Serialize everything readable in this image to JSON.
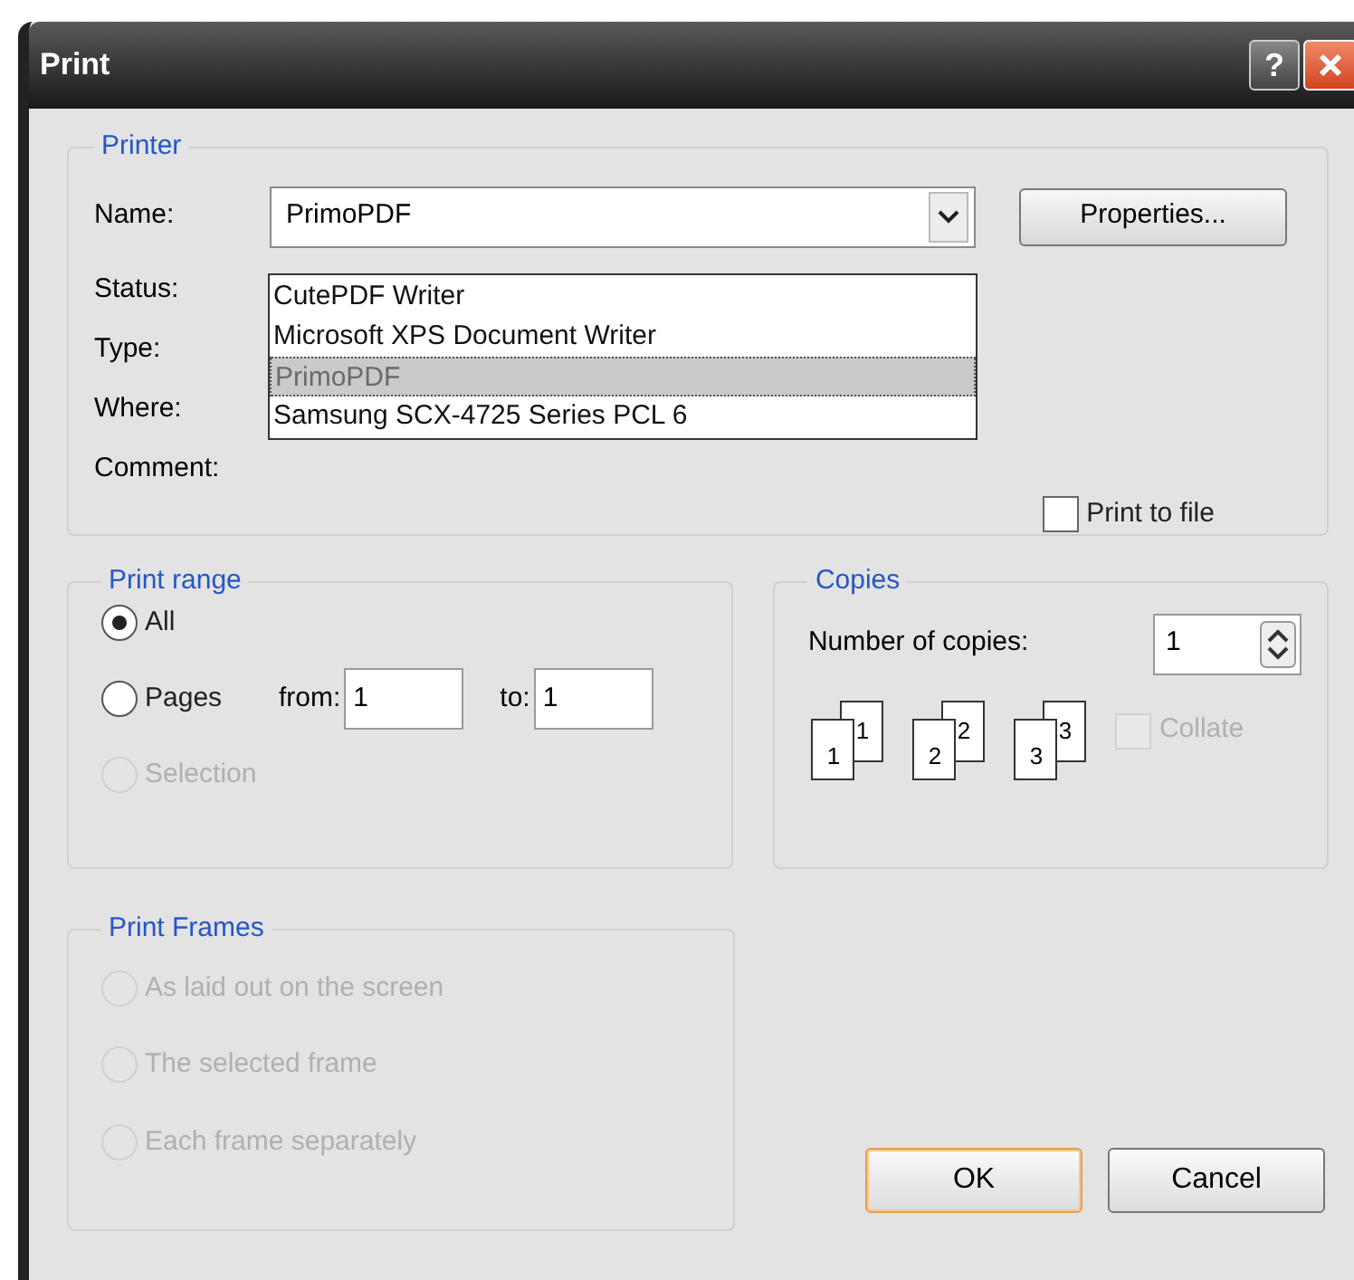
{
  "window": {
    "title": "Print",
    "help_button": "?"
  },
  "printer": {
    "title": "Printer",
    "name_label": "Name:",
    "name_value": "PrimoPDF",
    "dropdown_options": [
      {
        "label": "CutePDF Writer",
        "selected": false
      },
      {
        "label": "Microsoft XPS Document Writer",
        "selected": false
      },
      {
        "label": "PrimoPDF",
        "selected": true
      },
      {
        "label": "Samsung SCX-4725 Series PCL 6",
        "selected": false
      }
    ],
    "properties_button": "Properties...",
    "fields": [
      {
        "label": "Status:"
      },
      {
        "label": "Type:"
      },
      {
        "label": "Where:"
      },
      {
        "label": "Comment:"
      }
    ],
    "print_to_file": {
      "label": "Print to file",
      "checked": false
    }
  },
  "print_range": {
    "title": "Print range",
    "options": [
      {
        "kind": "plain",
        "label": "All",
        "selected": true,
        "disabled": false
      },
      {
        "kind": "pages",
        "label": "Pages",
        "selected": false,
        "disabled": false
      },
      {
        "kind": "plain",
        "label": "Selection",
        "selected": false,
        "disabled": true
      }
    ],
    "from_label": "from:",
    "from_value": "1",
    "to_label": "to:",
    "to_value": "1"
  },
  "copies": {
    "title": "Copies",
    "number_label": "Number of copies:",
    "number_value": "1",
    "collate_pages": [
      {
        "back": "1",
        "front": "1"
      },
      {
        "back": "2",
        "front": "2"
      },
      {
        "back": "3",
        "front": "3"
      }
    ],
    "collate": {
      "label": "Collate",
      "checked": false,
      "disabled": true
    }
  },
  "print_frames": {
    "title": "Print Frames",
    "options": [
      {
        "label": "As laid out on the screen",
        "selected": false,
        "disabled": true
      },
      {
        "label": "The selected frame",
        "selected": false,
        "disabled": true
      },
      {
        "label": "Each frame separately",
        "selected": false,
        "disabled": true
      }
    ]
  },
  "buttons": [
    {
      "label": "OK",
      "default": true
    },
    {
      "label": "Cancel",
      "default": false
    }
  ]
}
